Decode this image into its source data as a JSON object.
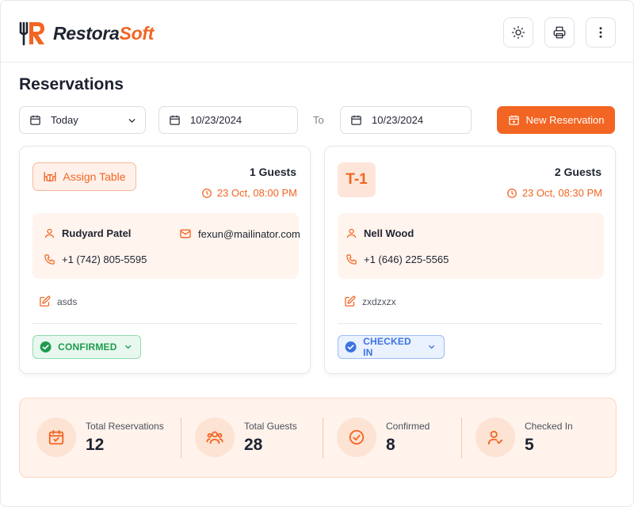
{
  "app": {
    "logo_part1": "Restora",
    "logo_part2": "Soft",
    "brand_color": "#f26522"
  },
  "header": {
    "icons": [
      "sun-icon",
      "printer-icon",
      "more-vertical-icon"
    ]
  },
  "page": {
    "title": "Reservations"
  },
  "filters": {
    "range_label": "Today",
    "from_date": "10/23/2024",
    "to_label": "To",
    "to_date": "10/23/2024",
    "new_button": "New Reservation"
  },
  "reservations": [
    {
      "action_label": "Assign Table",
      "guests": "1 Guests",
      "time": "23 Oct, 08:00 PM",
      "name": "Rudyard Patel",
      "email": "fexun@mailinator.com",
      "phone": "+1 (742) 805-5595",
      "note": "asds",
      "status": "CONFIRMED",
      "status_color": "#1e9b4f"
    },
    {
      "table": "T-1",
      "guests": "2 Guests",
      "time": "23 Oct, 08:30 PM",
      "name": "Nell Wood",
      "phone": "+1 (646) 225-5565",
      "note": "zxdzxzx",
      "status": "CHECKED IN",
      "status_color": "#3b74e0"
    }
  ],
  "stats": [
    {
      "label": "Total Reservations",
      "value": "12",
      "icon": "calendar-check-icon"
    },
    {
      "label": "Total Guests",
      "value": "28",
      "icon": "users-icon"
    },
    {
      "label": "Confirmed",
      "value": "8",
      "icon": "check-circle-icon"
    },
    {
      "label": "Checked In",
      "value": "5",
      "icon": "user-check-icon"
    }
  ]
}
